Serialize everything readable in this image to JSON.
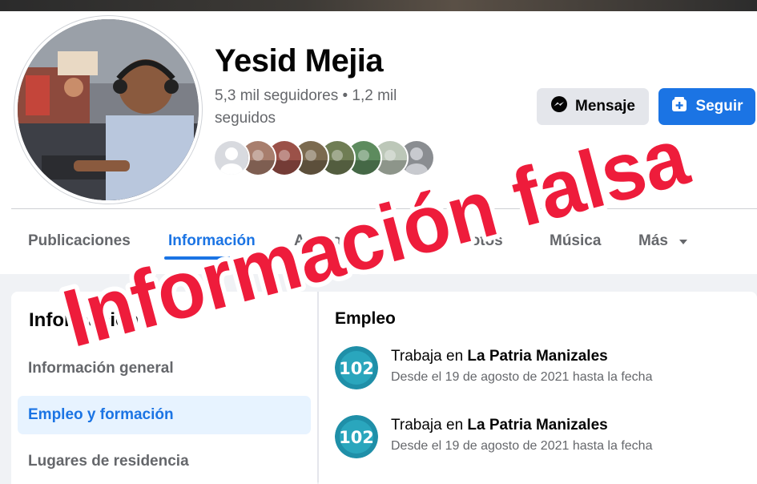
{
  "profile": {
    "name": "Yesid Mejia",
    "stats": "5,3 mil seguidores • 1,2 mil seguidos",
    "message_label": "Mensaje",
    "follow_label": "Seguir",
    "message_icon": "messenger-icon",
    "follow_icon": "follow-plus-icon",
    "friend_avatar_count": 8
  },
  "tabs": [
    {
      "label": "Publicaciones"
    },
    {
      "label": "Información"
    },
    {
      "label": "Amigos"
    },
    {
      "label": "Fotos"
    },
    {
      "label": "Música"
    },
    {
      "label": "Más"
    }
  ],
  "sidebar": {
    "title": "Información",
    "items": [
      {
        "label": "Información general"
      },
      {
        "label": "Empleo y formación"
      },
      {
        "label": "Lugares de residencia"
      }
    ]
  },
  "employment": {
    "title": "Empleo",
    "jobs": [
      {
        "prefix": "Trabaja en ",
        "company": "La Patria Manizales",
        "dates": "Desde el 19 de agosto de 2021 hasta la fecha",
        "logo_text": "102"
      },
      {
        "prefix": "Trabaja en ",
        "company": "La Patria Manizales",
        "dates": "Desde el 19 de agosto de 2021 hasta la fecha",
        "logo_text": "102"
      }
    ]
  },
  "overlay": {
    "line1": "Información falsa",
    "color": "#ee1c3b"
  },
  "colors": {
    "accent": "#1b74e4",
    "active_bg": "#e7f3ff",
    "secondary_text": "#65676b"
  }
}
